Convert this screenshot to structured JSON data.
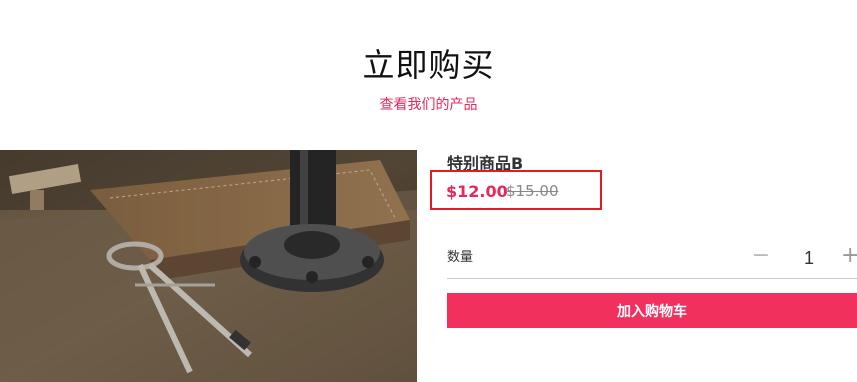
{
  "page": {
    "title": "立即购买",
    "subtitle": "查看我们的产品"
  },
  "product": {
    "name": "特别商品B",
    "price": "$12.00",
    "original_price": "$15.00",
    "image_description": "photo-of-drafting-compass-and-pipe-fitting-on-wooden-desk"
  },
  "quantity": {
    "label": "数量",
    "value": "1",
    "minus_symbol": "−",
    "plus_symbol": "+"
  },
  "actions": {
    "add_to_cart_label": "加入购物车"
  },
  "colors": {
    "accent": "#f2305e",
    "price": "#e6285a",
    "highlight_border": "#e01b24"
  }
}
